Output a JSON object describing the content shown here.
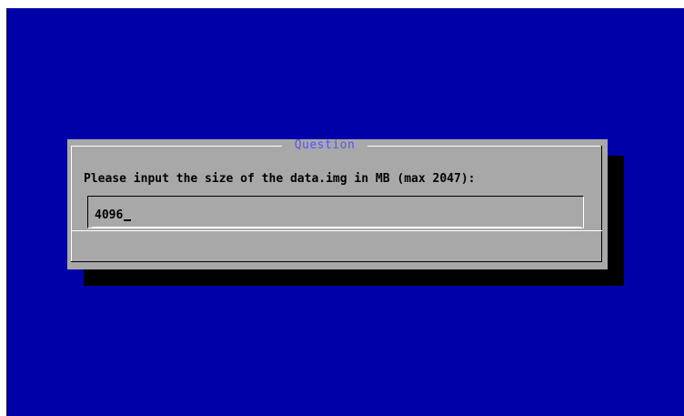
{
  "dialog": {
    "title": "Question",
    "prompt": "Please input the size of the data.img in MB (max 2047):",
    "input": {
      "value": "4096"
    }
  },
  "colors": {
    "screen_background": "#0000a8",
    "dialog_background": "#a8a8a8",
    "title_color": "#5454fc",
    "shadow": "#000000"
  }
}
